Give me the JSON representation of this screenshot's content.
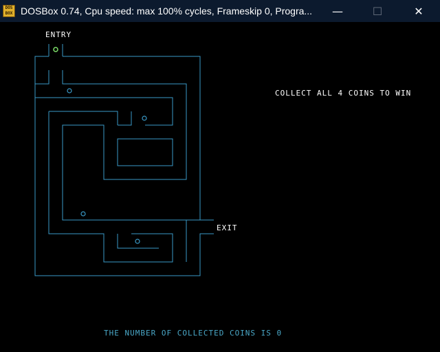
{
  "window": {
    "title": "DOSBox 0.74, Cpu speed: max 100% cycles, Frameskip  0, Progra...",
    "icon_text": "DOS BOX",
    "icon_name": "dosbox-icon",
    "minimize_icon": "minimize-icon",
    "maximize_icon": "maximize-icon",
    "close_icon": "close-icon",
    "titlebar_color": "#0c1a2e"
  },
  "game": {
    "entry_label": "ENTRY",
    "exit_label": "EXIT",
    "instruction": "COLLECT ALL 4 COINS TO WIN",
    "status": "THE NUMBER OF COLLECTED COINS IS 0",
    "coins_total": 4,
    "coins_collected": 0,
    "colors": {
      "walls": "#3a9ac8",
      "coins": "#3a9ac8",
      "player": "#7ee06a",
      "text": "#ffffff",
      "status_text": "#4aa8c8"
    }
  }
}
